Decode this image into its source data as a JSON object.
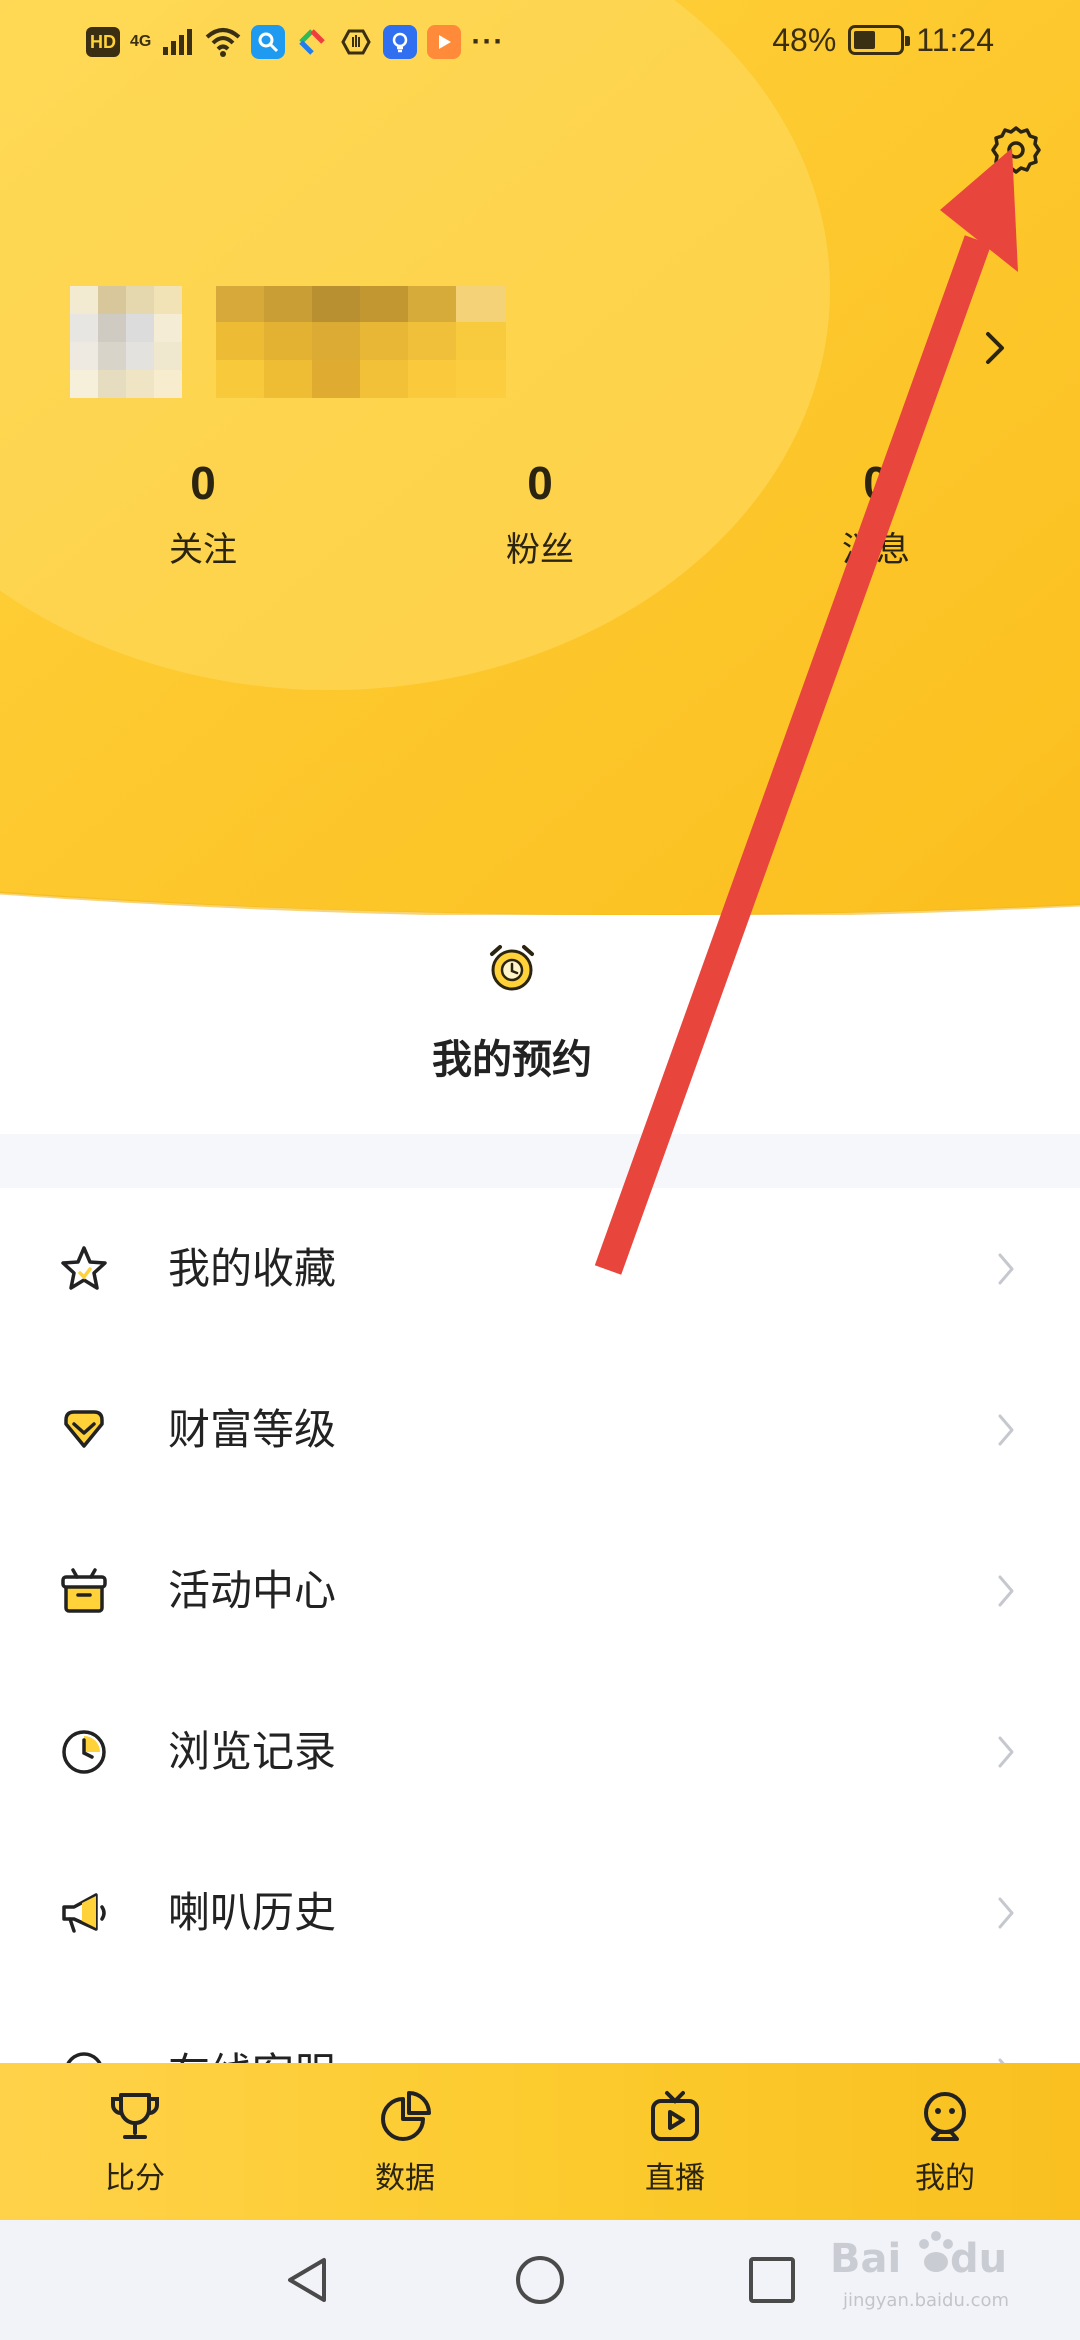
{
  "status_bar": {
    "hd_badge": "HD",
    "network": "4G",
    "battery_percent": "48%",
    "battery_level": 0.48,
    "time": "11:24",
    "more_indicator": "···"
  },
  "header": {
    "settings_icon": "gear-icon",
    "profile_chevron_icon": "chevron-right-icon",
    "stats": [
      {
        "value": "0",
        "label": "关注"
      },
      {
        "value": "0",
        "label": "粉丝"
      },
      {
        "value": "0",
        "label": "消息"
      }
    ]
  },
  "reservation": {
    "icon": "alarm-clock-icon",
    "label": "我的预约"
  },
  "menu": {
    "items": [
      {
        "label": "我的收藏",
        "icon": "star-icon"
      },
      {
        "label": "财富等级",
        "icon": "diamond-heart-icon"
      },
      {
        "label": "活动中心",
        "icon": "gift-box-icon"
      },
      {
        "label": "浏览记录",
        "icon": "clock-icon"
      },
      {
        "label": "喇叭历史",
        "icon": "megaphone-icon"
      },
      {
        "label": "在线客服",
        "icon": "headset-icon"
      }
    ]
  },
  "tabbar": {
    "tabs": [
      {
        "label": "比分",
        "icon": "trophy-icon"
      },
      {
        "label": "数据",
        "icon": "pie-chart-icon"
      },
      {
        "label": "直播",
        "icon": "tv-play-icon"
      },
      {
        "label": "我的",
        "icon": "profile-face-icon"
      }
    ],
    "active_index": 3
  },
  "system_nav": {
    "back_icon": "triangle-back-icon",
    "home_icon": "circle-home-icon",
    "recents_icon": "square-recents-icon"
  },
  "watermark": {
    "brand": "Baidu经验",
    "url": "jingyan.baidu.com"
  },
  "colors": {
    "header_yellow": "#ffc928",
    "header_yellow_light": "#ffd84a",
    "annotation_arrow": "#e8453c",
    "icon_accent": "#ffd23a",
    "text_dark": "#222222"
  }
}
